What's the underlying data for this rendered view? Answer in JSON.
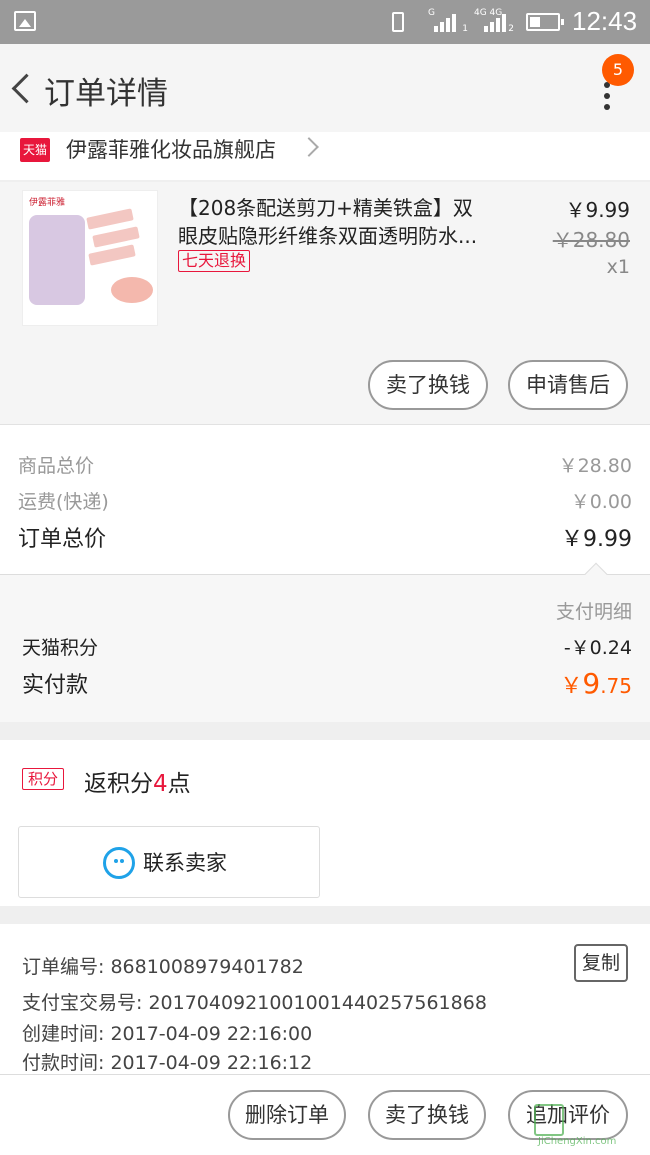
{
  "status_bar": {
    "time": "12:43",
    "signal1_label": "G",
    "signal1_sub": "1",
    "signal2_label": "4G 4G",
    "signal2_sub": "2"
  },
  "header": {
    "title": "订单详情",
    "badge_count": "5"
  },
  "store": {
    "logo_text": "天猫",
    "name": "伊露菲雅化妆品旗舰店"
  },
  "product": {
    "brand_text": "伊露菲雅",
    "title_line1": "【208条配送剪刀+精美铁盒】双",
    "title_line2": "眼皮贴隐形纤维条双面透明防水...",
    "tag": "七天退换",
    "price": "￥9.99",
    "original_price": "￥28.80",
    "quantity": "x1",
    "btn_sell": "卖了换钱",
    "btn_aftersale": "申请售后"
  },
  "totals": {
    "goods_label": "商品总价",
    "goods_value": "￥28.80",
    "shipping_label": "运费(快递)",
    "shipping_value": "￥0.00",
    "order_label": "订单总价",
    "order_value": "￥9.99"
  },
  "payment_detail": {
    "title": "支付明细",
    "points_label": "天猫积分",
    "points_value": "-￥0.24",
    "paid_label": "实付款",
    "paid_currency": "￥",
    "paid_int": "9",
    "paid_dec": ".75"
  },
  "points": {
    "tag": "积分",
    "text_prefix": "返积分",
    "count": "4",
    "text_suffix": "点"
  },
  "contact": {
    "label": "联系卖家"
  },
  "order_info": {
    "order_no": "订单编号: 8681008979401782",
    "alipay_no": "支付宝交易号: 2017040921001001440257561868",
    "created": "创建时间: 2017-04-09 22:16:00",
    "paid": "付款时间: 2017-04-09 22:16:12",
    "copy_label": "复制"
  },
  "bottom_bar": {
    "delete": "删除订单",
    "sell": "卖了换钱",
    "review": "追加评价"
  },
  "watermark": {
    "text": "JiChengXin.com"
  },
  "colors": {
    "accent": "#ff5a00",
    "tmall_red": "#e8173c",
    "contact_blue": "#1fa2e8"
  }
}
